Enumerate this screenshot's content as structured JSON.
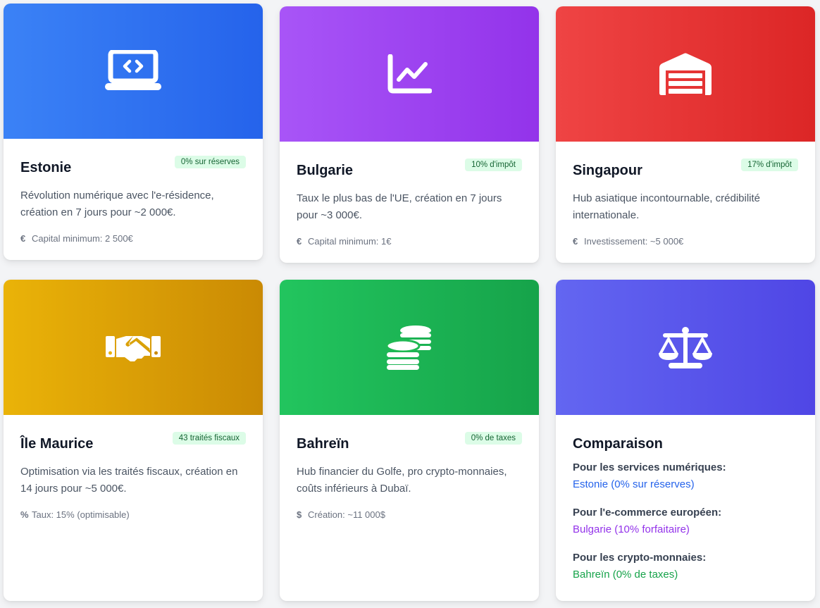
{
  "cards": [
    {
      "title": "Estonie",
      "badge": "0% sur réserves",
      "description": "Révolution numérique avec l'e-résidence, création en 7 jours pour ~2 000€.",
      "meta_icon": "€",
      "meta": "Capital minimum: 2 500€",
      "banner_icon": "laptop-code-icon",
      "colors": [
        "#3b82f6",
        "#2563eb"
      ]
    },
    {
      "title": "Bulgarie",
      "badge": "10% d'impôt",
      "description": "Taux le plus bas de l'UE, création en 7 jours pour ~3 000€.",
      "meta_icon": "€",
      "meta": "Capital minimum: 1€",
      "banner_icon": "chart-line-icon",
      "colors": [
        "#a855f7",
        "#9333ea"
      ]
    },
    {
      "title": "Singapour",
      "badge": "17% d'impôt",
      "description": "Hub asiatique incontournable, crédibilité internationale.",
      "meta_icon": "€",
      "meta": "Investissement: ~5 000€",
      "banner_icon": "warehouse-icon",
      "colors": [
        "#ef4444",
        "#dc2626"
      ]
    },
    {
      "title": "Île Maurice",
      "badge": "43 traités fiscaux",
      "description": "Optimisation via les traités fiscaux, création en 14 jours pour ~5 000€.",
      "meta_icon": "%",
      "meta": "Taux: 15% (optimisable)",
      "banner_icon": "handshake-icon",
      "colors": [
        "#eab308",
        "#ca8a04"
      ]
    },
    {
      "title": "Bahreïn",
      "badge": "0% de taxes",
      "description": "Hub financier du Golfe, pro crypto-monnaies, coûts inférieurs à Dubaï.",
      "meta_icon": "$",
      "meta": "Création: ~11 000$",
      "banner_icon": "coins-icon",
      "colors": [
        "#22c55e",
        "#16a34a"
      ]
    }
  ],
  "comparison": {
    "title": "Comparaison",
    "banner_icon": "balance-scale-icon",
    "colors": [
      "#6366f1",
      "#4f46e5"
    ],
    "items": [
      {
        "label": "Pour les services numériques:",
        "value": "Estonie (0% sur réserves)",
        "color": "#2563eb"
      },
      {
        "label": "Pour l'e-commerce européen:",
        "value": "Bulgarie (10% forfaitaire)",
        "color": "#9333ea"
      },
      {
        "label": "Pour les crypto-monnaies:",
        "value": "Bahreïn (0% de taxes)",
        "color": "#16a34a"
      }
    ]
  }
}
